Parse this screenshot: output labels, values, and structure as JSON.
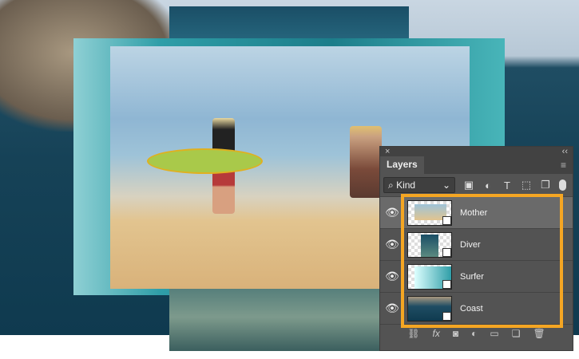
{
  "panel": {
    "close": "×",
    "collapse": "‹‹",
    "tab": "Layers",
    "menu": "≡",
    "filter": {
      "search_icon": "⌕",
      "kind": "Kind",
      "chevron": "⌄",
      "icons": [
        "image-filter-icon",
        "adjustment-filter-icon",
        "type-filter-icon",
        "shape-filter-icon",
        "smart-object-filter-icon"
      ],
      "glyphs": [
        "▣",
        "◐",
        "T",
        "⬚",
        "❐"
      ]
    },
    "layers": [
      {
        "name": "Mother",
        "selected": true
      },
      {
        "name": "Diver",
        "selected": false
      },
      {
        "name": "Surfer",
        "selected": false
      },
      {
        "name": "Coast",
        "selected": false
      }
    ],
    "eye": "👁",
    "bottom": {
      "glyphs": [
        "⛓",
        "fx",
        "◙",
        "◐",
        "▭",
        "❏",
        "🗑"
      ],
      "names": [
        "link-layers-icon",
        "fx-icon",
        "mask-icon",
        "adjustment-layer-icon",
        "group-folder-icon",
        "new-layer-icon",
        "trash-icon"
      ]
    }
  },
  "colors": {
    "highlight": "#f5a623"
  }
}
